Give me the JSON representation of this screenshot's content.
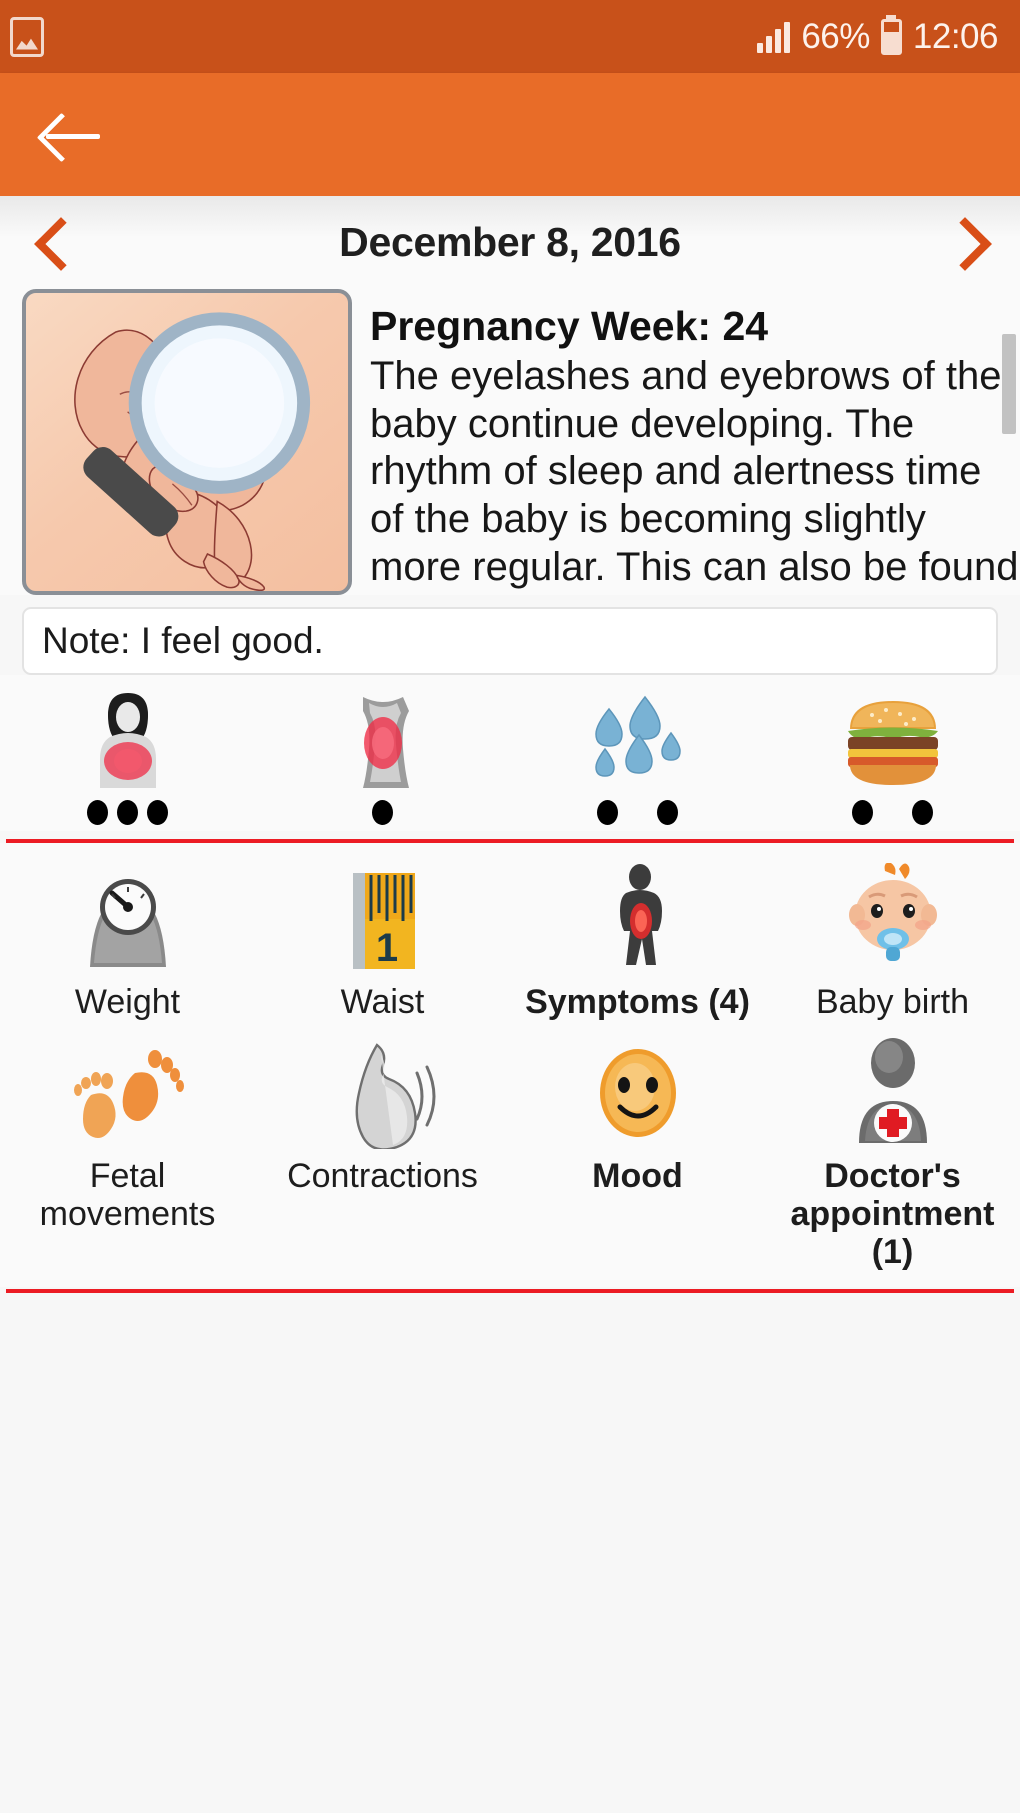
{
  "status_bar": {
    "notification_icon": "photo-gallery-icon",
    "signal_icon": "signal-bars-icon",
    "battery_percent": "66%",
    "battery_icon": "battery-icon",
    "time": "12:06"
  },
  "app_bar": {
    "back_icon": "back-arrow-icon"
  },
  "date_nav": {
    "prev_icon": "chevron-left-icon",
    "next_icon": "chevron-right-icon",
    "date": "December 8, 2016"
  },
  "week_card": {
    "fetus_image": "fetus-illustration",
    "magnifier_icon": "magnifier-icon",
    "title": "Pregnancy Week: 24",
    "body": "The eyelashes and eyebrows of the baby continue developing. The rhythm of sleep and alertness time of the baby is becoming slightly more regular. This can also be found",
    "scrollbar": "vertical-scrollbar"
  },
  "note": {
    "text": "Note: I feel good.",
    "placeholder": "Note:"
  },
  "symptoms_strip": {
    "items": [
      {
        "icon": "breast-pain-icon",
        "dots": 3
      },
      {
        "icon": "abdominal-pain-icon",
        "dots": 1
      },
      {
        "icon": "sweating-drops-icon",
        "dots": 2
      },
      {
        "icon": "appetite-burger-icon",
        "dots": 2
      }
    ]
  },
  "tracker_grid": {
    "rows": [
      [
        {
          "icon": "weight-scale-icon",
          "label": "Weight",
          "bold": false
        },
        {
          "icon": "tape-measure-icon",
          "label": "Waist",
          "bold": false
        },
        {
          "icon": "symptoms-person-icon",
          "label": "Symptoms (4)",
          "bold": true
        },
        {
          "icon": "baby-birth-icon",
          "label": "Baby birth",
          "bold": false
        }
      ],
      [
        {
          "icon": "footprints-icon",
          "label": "Fetal movements",
          "bold": false
        },
        {
          "icon": "contractions-belly-icon",
          "label": "Contractions",
          "bold": false
        },
        {
          "icon": "mood-smiley-icon",
          "label": "Mood",
          "bold": true
        },
        {
          "icon": "doctor-icon",
          "label": "Doctor's appointment (1)",
          "bold": true
        }
      ]
    ]
  },
  "colors": {
    "status_bar": "#c8511a",
    "app_bar": "#e86c28",
    "accent_orange": "#d94e17",
    "divider_red": "#ec1c24",
    "page_bg": "#f7f7f7"
  }
}
